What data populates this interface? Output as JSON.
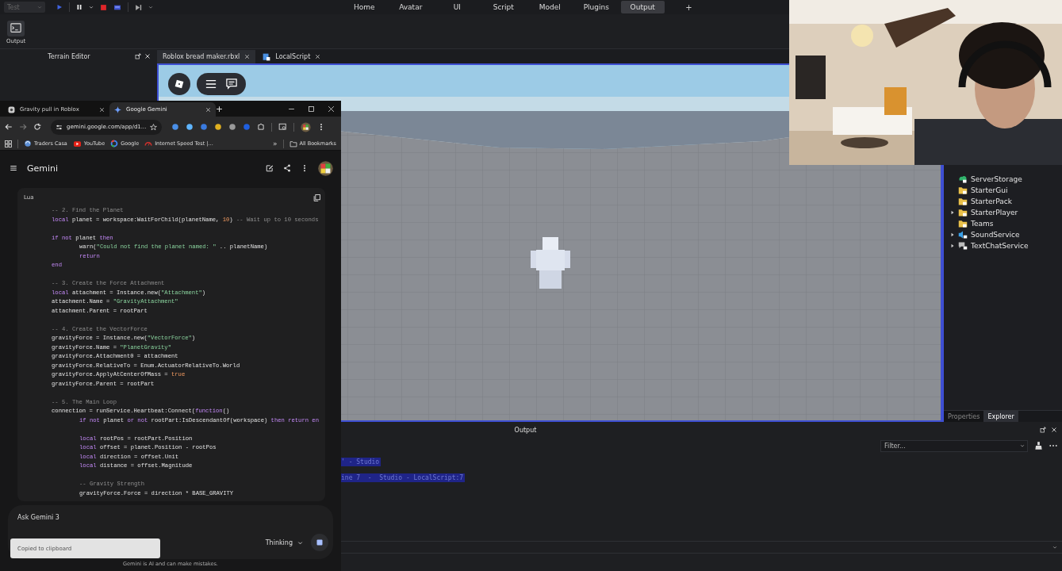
{
  "studio": {
    "test_dropdown": "Test",
    "ribbon_tabs": [
      {
        "label": "Home",
        "selected": false
      },
      {
        "label": "Avatar",
        "selected": false
      },
      {
        "label": "UI",
        "selected": false
      },
      {
        "label": "Script",
        "selected": false
      },
      {
        "label": "Model",
        "selected": false
      },
      {
        "label": "Plugins",
        "selected": false
      },
      {
        "label": "Output",
        "selected": true
      }
    ],
    "add_tab": "+",
    "toolbar_button": "Output",
    "left_panel_title": "Terrain Editor",
    "document_tabs": [
      {
        "label": "Roblox bread maker.rbxl",
        "kind": "place",
        "selected": true
      },
      {
        "label": "LocalScript",
        "kind": "script",
        "selected": false
      }
    ],
    "explorer_items": [
      {
        "label": "ServerStorage",
        "kind": "storage",
        "has_children": false
      },
      {
        "label": "StarterGui",
        "kind": "folder",
        "has_children": false
      },
      {
        "label": "StarterPack",
        "kind": "folder",
        "has_children": false
      },
      {
        "label": "StarterPlayer",
        "kind": "folder",
        "has_children": true
      },
      {
        "label": "Teams",
        "kind": "folder",
        "has_children": false
      },
      {
        "label": "SoundService",
        "kind": "sound",
        "has_children": true
      },
      {
        "label": "TextChatService",
        "kind": "chat",
        "has_children": true
      }
    ],
    "panel_tabs": [
      {
        "label": "Properties",
        "selected": false
      },
      {
        "label": "Explorer",
        "selected": true
      }
    ],
    "output": {
      "title": "Output",
      "filter_placeholder": "Filter...",
      "lines": [
        {
          "text": "' - Studio",
          "selected": true
        },
        {
          "text": "ine 7  -  Studio - LocalScript:7",
          "selected": true
        }
      ]
    }
  },
  "browser": {
    "tabs": [
      {
        "title": "Gravity pull in Roblox",
        "selected": false
      },
      {
        "title": "Google Gemini",
        "selected": true
      }
    ],
    "url": "gemini.google.com/app/d1...",
    "bookmarks": [
      {
        "label": "Traders Casa",
        "kind": "site"
      },
      {
        "label": "YouTube",
        "kind": "video"
      },
      {
        "label": "Google",
        "kind": "ring"
      },
      {
        "label": "Internet Speed Test |...",
        "kind": "gauge"
      }
    ],
    "more_bookmarks": "»",
    "all_bookmarks": "All Bookmarks"
  },
  "gemini": {
    "title": "Gemini",
    "code": {
      "language": "Lua",
      "blocks": [
        [
          {
            "indented": false,
            "segments": [
              {
                "kind": "comment",
                "text": "-- 2. Find the Planet"
              }
            ]
          },
          {
            "indented": false,
            "segments": [
              {
                "kind": "keyword",
                "text": "local"
              },
              {
                "kind": "plain",
                "text": " planet = workspace:WaitForChild(planetName, "
              },
              {
                "kind": "number",
                "text": "10"
              },
              {
                "kind": "plain",
                "text": ") "
              },
              {
                "kind": "comment",
                "text": "-- Wait up to 10 seconds"
              }
            ]
          }
        ],
        [
          {
            "indented": false,
            "segments": [
              {
                "kind": "keyword",
                "text": "if not"
              },
              {
                "kind": "plain",
                "text": " planet "
              },
              {
                "kind": "keyword",
                "text": "then"
              }
            ]
          },
          {
            "indented": true,
            "segments": [
              {
                "kind": "plain",
                "text": "warn("
              },
              {
                "kind": "string",
                "text": "\"Could not find the planet named: \""
              },
              {
                "kind": "plain",
                "text": " .. planetName)"
              }
            ]
          },
          {
            "indented": true,
            "segments": [
              {
                "kind": "keyword",
                "text": "return"
              }
            ]
          },
          {
            "indented": false,
            "segments": [
              {
                "kind": "keyword",
                "text": "end"
              }
            ]
          }
        ],
        [
          {
            "indented": false,
            "segments": [
              {
                "kind": "comment",
                "text": "-- 3. Create the Force Attachment"
              }
            ]
          },
          {
            "indented": false,
            "segments": [
              {
                "kind": "keyword",
                "text": "local"
              },
              {
                "kind": "plain",
                "text": " attachment = Instance.new("
              },
              {
                "kind": "string",
                "text": "\"Attachment\""
              },
              {
                "kind": "plain",
                "text": ")"
              }
            ]
          },
          {
            "indented": false,
            "segments": [
              {
                "kind": "plain",
                "text": "attachment.Name = "
              },
              {
                "kind": "string",
                "text": "\"GravityAttachment\""
              }
            ]
          },
          {
            "indented": false,
            "segments": [
              {
                "kind": "plain",
                "text": "attachment.Parent = rootPart"
              }
            ]
          }
        ],
        [
          {
            "indented": false,
            "segments": [
              {
                "kind": "comment",
                "text": "-- 4. Create the VectorForce"
              }
            ]
          },
          {
            "indented": false,
            "segments": [
              {
                "kind": "plain",
                "text": "gravityForce = Instance.new("
              },
              {
                "kind": "string",
                "text": "\"VectorForce\""
              },
              {
                "kind": "plain",
                "text": ")"
              }
            ]
          },
          {
            "indented": false,
            "segments": [
              {
                "kind": "plain",
                "text": "gravityForce.Name = "
              },
              {
                "kind": "string",
                "text": "\"PlanetGravity\""
              }
            ]
          },
          {
            "indented": false,
            "segments": [
              {
                "kind": "plain",
                "text": "gravityForce.Attachment0 = attachment"
              }
            ]
          },
          {
            "indented": false,
            "segments": [
              {
                "kind": "plain",
                "text": "gravityForce.RelativeTo = Enum.ActuatorRelativeTo.World"
              }
            ]
          },
          {
            "indented": false,
            "segments": [
              {
                "kind": "plain",
                "text": "gravityForce.ApplyAtCenterOfMass = "
              },
              {
                "kind": "number",
                "text": "true"
              }
            ]
          },
          {
            "indented": false,
            "segments": [
              {
                "kind": "plain",
                "text": "gravityForce.Parent = rootPart"
              }
            ]
          }
        ],
        [
          {
            "indented": false,
            "segments": [
              {
                "kind": "comment",
                "text": "-- 5. The Main Loop"
              }
            ]
          },
          {
            "indented": false,
            "segments": [
              {
                "kind": "plain",
                "text": "connection = runService.Heartbeat:Connect("
              },
              {
                "kind": "keyword",
                "text": "function"
              },
              {
                "kind": "plain",
                "text": "()"
              }
            ]
          },
          {
            "indented": true,
            "segments": [
              {
                "kind": "keyword",
                "text": "if not"
              },
              {
                "kind": "plain",
                "text": " planet "
              },
              {
                "kind": "keyword",
                "text": "or not"
              },
              {
                "kind": "plain",
                "text": " rootPart:IsDescendantOf(workspace) "
              },
              {
                "kind": "keyword",
                "text": "then return en"
              }
            ]
          }
        ],
        [
          {
            "indented": true,
            "segments": [
              {
                "kind": "keyword",
                "text": "local"
              },
              {
                "kind": "plain",
                "text": " rootPos = rootPart.Position"
              }
            ]
          },
          {
            "indented": true,
            "segments": [
              {
                "kind": "keyword",
                "text": "local"
              },
              {
                "kind": "plain",
                "text": " offset = planet.Position - rootPos"
              }
            ]
          },
          {
            "indented": true,
            "segments": [
              {
                "kind": "keyword",
                "text": "local"
              },
              {
                "kind": "plain",
                "text": " direction = offset.Unit"
              }
            ]
          },
          {
            "indented": true,
            "segments": [
              {
                "kind": "keyword",
                "text": "local"
              },
              {
                "kind": "plain",
                "text": " distance = offset.Magnitude"
              }
            ]
          }
        ],
        [
          {
            "indented": true,
            "segments": [
              {
                "kind": "comment",
                "text": "-- Gravity Strength"
              }
            ]
          },
          {
            "indented": true,
            "segments": [
              {
                "kind": "plain",
                "text": "gravityForce.Force = direction * BASE_GRAVITY"
              }
            ]
          }
        ]
      ]
    },
    "input_placeholder": "Ask Gemini 3",
    "mode": "Thinking",
    "toast": "Copied to clipboard",
    "disclaimer": "Gemini is AI and can make mistakes."
  }
}
